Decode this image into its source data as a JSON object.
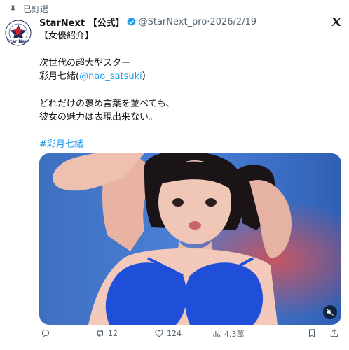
{
  "pinned": {
    "label": "已釘選",
    "icon": "pin-icon"
  },
  "account": {
    "avatar_text": "Star Next",
    "avatar_ring_text": "Model Production",
    "name": "StarNext 【公式】",
    "verified_icon": "verified-badge-icon",
    "handle": "@StarNext_pro",
    "separator": "·",
    "date": "2026/2/19"
  },
  "platform_icon": "x-logo-icon",
  "tweet": {
    "line1": "【女優紹介】",
    "line2": "次世代の超大型スター",
    "line3_prefix": "彩月七緒(",
    "line3_mention": "@nao_satsuki",
    "line3_suffix": "）",
    "line4": "どれだけの褒め言葉を並べても、",
    "line5": "彼女の魅力は表現出来ない。",
    "hashtag": "#彩月七緒"
  },
  "media": {
    "type": "video",
    "mute_icon": "muted-speaker-icon"
  },
  "actions": {
    "reply": {
      "icon": "reply-icon",
      "count": ""
    },
    "retweet": {
      "icon": "retweet-icon",
      "count": "12"
    },
    "like": {
      "icon": "heart-icon",
      "count": "124"
    },
    "views": {
      "icon": "views-icon",
      "count": "4.3萬"
    },
    "bookmark": {
      "icon": "bookmark-icon"
    },
    "share": {
      "icon": "share-icon"
    }
  },
  "colors": {
    "link": "#1d9bf0",
    "secondary_text": "#536471",
    "verified": "#1d9bf0"
  }
}
